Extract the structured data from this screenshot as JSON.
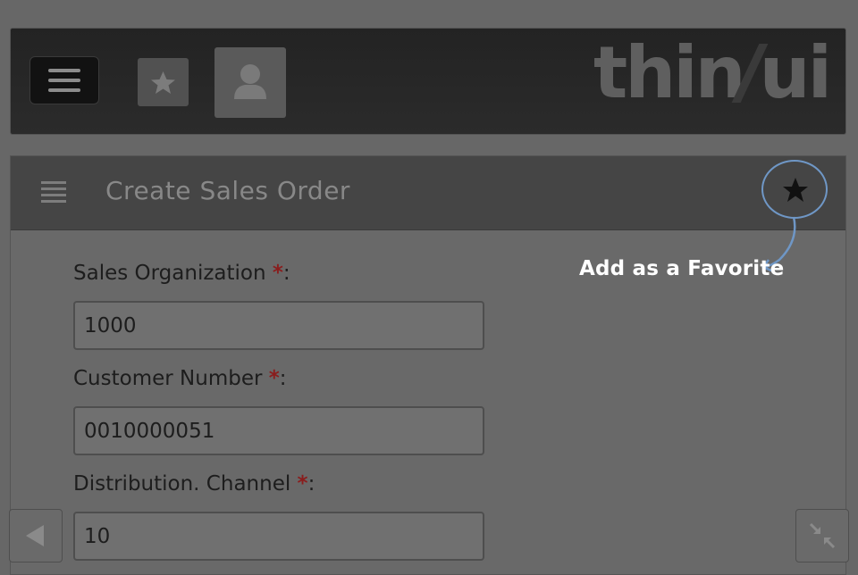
{
  "header": {
    "logo_text": "thinui",
    "menu_icon": "hamburger-menu-icon",
    "favorites_icon": "star-icon",
    "profile_icon": "user-icon"
  },
  "page": {
    "title": "Create Sales Order",
    "list_icon": "list-icon",
    "favorite_icon": "star-icon"
  },
  "callout": {
    "text": "Add as a Favorite",
    "color": "#ffffff"
  },
  "form": {
    "required_marker": "*",
    "fields": [
      {
        "label": "Sales Organization",
        "suffix": ":",
        "value": "1000"
      },
      {
        "label": "Customer Number",
        "suffix": ":",
        "value": "0010000051"
      },
      {
        "label": "Distribution. Channel",
        "suffix": ":",
        "value": "10"
      }
    ]
  },
  "footer": {
    "back_icon": "back-arrow-icon",
    "collapse_icon": "collapse-icon"
  },
  "colors": {
    "background": "#676767",
    "header_bg": "#232323",
    "panel_header_bg": "#454545",
    "required_marker": "#8a1d1d",
    "highlight_circle": "#6f97c6"
  }
}
